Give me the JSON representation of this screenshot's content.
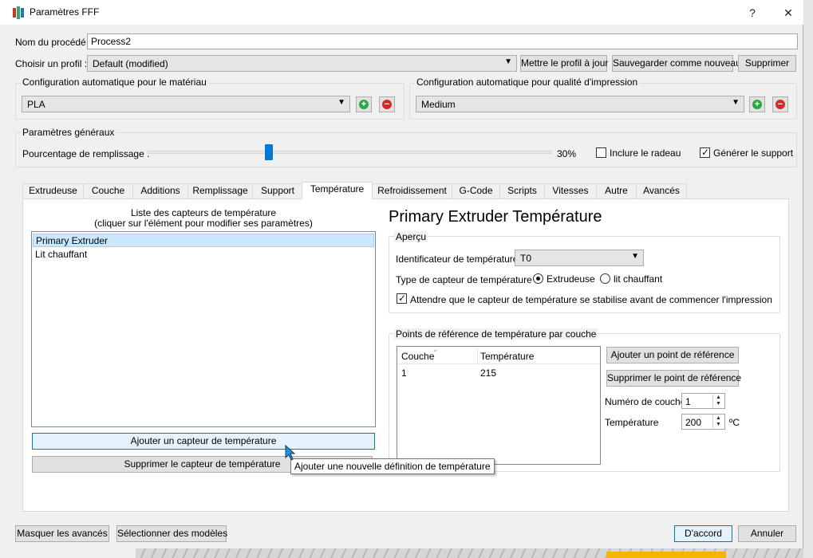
{
  "window": {
    "title": "Paramètres FFF",
    "help_glyph": "?",
    "close_glyph": "✕"
  },
  "process": {
    "name_label": "Nom du procédé :",
    "name_value": "Process2",
    "profile_label": "Choisir un profil :",
    "profile_value": "Default (modified)",
    "update_btn": "Mettre le profil à jour",
    "save_new_btn": "Sauvegarder comme nouveau",
    "delete_btn": "Supprimer"
  },
  "auto_material": {
    "title": "Configuration automatique pour le matériau",
    "value": "PLA"
  },
  "auto_quality": {
    "title": "Configuration automatique pour qualité d'impression",
    "value": "Medium"
  },
  "general": {
    "title": "Paramètres généraux",
    "infill_label": "Pourcentage de remplissage :",
    "infill_value": "30%",
    "infill_fraction": 0.3,
    "raft_label": "Inclure le radeau",
    "raft_checked": false,
    "support_label": "Générer le support",
    "support_checked": true
  },
  "tabs": [
    "Extrudeuse",
    "Couche",
    "Additions",
    "Remplissage",
    "Support",
    "Température",
    "Refroidissement",
    "G-Code",
    "Scripts",
    "Vitesses",
    "Autre",
    "Avancés"
  ],
  "active_tab": "Température",
  "sensors": {
    "list_title_1": "Liste des capteurs de température",
    "list_title_2": "(cliquer sur l'élément pour modifier ses paramètres)",
    "items": [
      "Primary Extruder",
      "Lit chauffant"
    ],
    "add_btn": "Ajouter un capteur de température",
    "remove_btn": "Supprimer le capteur de température",
    "tooltip": "Ajouter une nouvelle définition de température"
  },
  "detail": {
    "heading": "Primary Extruder Température",
    "overview_title": "Aperçu",
    "id_label": "Identificateur de température",
    "id_value": "T0",
    "type_label": "Type de capteur de température :",
    "type_extruder": "Extrudeuse",
    "type_bed": "lit chauffant",
    "wait_label": "Attendre que le capteur de température se stabilise avant de commencer l'impression"
  },
  "setpoints": {
    "title": "Points de référence de température par couche",
    "col_layer": "Couche",
    "col_temp": "Température",
    "rows": [
      {
        "layer": "1",
        "temp": "215"
      }
    ],
    "add_btn": "Ajouter un point de référence",
    "remove_btn": "Supprimer le point de référence",
    "layer_label": "Numéro de couche",
    "layer_value": "1",
    "temp_label": "Température",
    "temp_value": "200",
    "temp_unit": "ºC"
  },
  "footer": {
    "hide_adv_btn": "Masquer les avancés",
    "select_models_btn": "Sélectionner des modèles",
    "ok_btn": "D'accord",
    "cancel_btn": "Annuler"
  },
  "colors": {
    "accent": "#0078d7",
    "selection": "#cce8ff",
    "plus": "#29a745",
    "minus": "#d9262b"
  }
}
